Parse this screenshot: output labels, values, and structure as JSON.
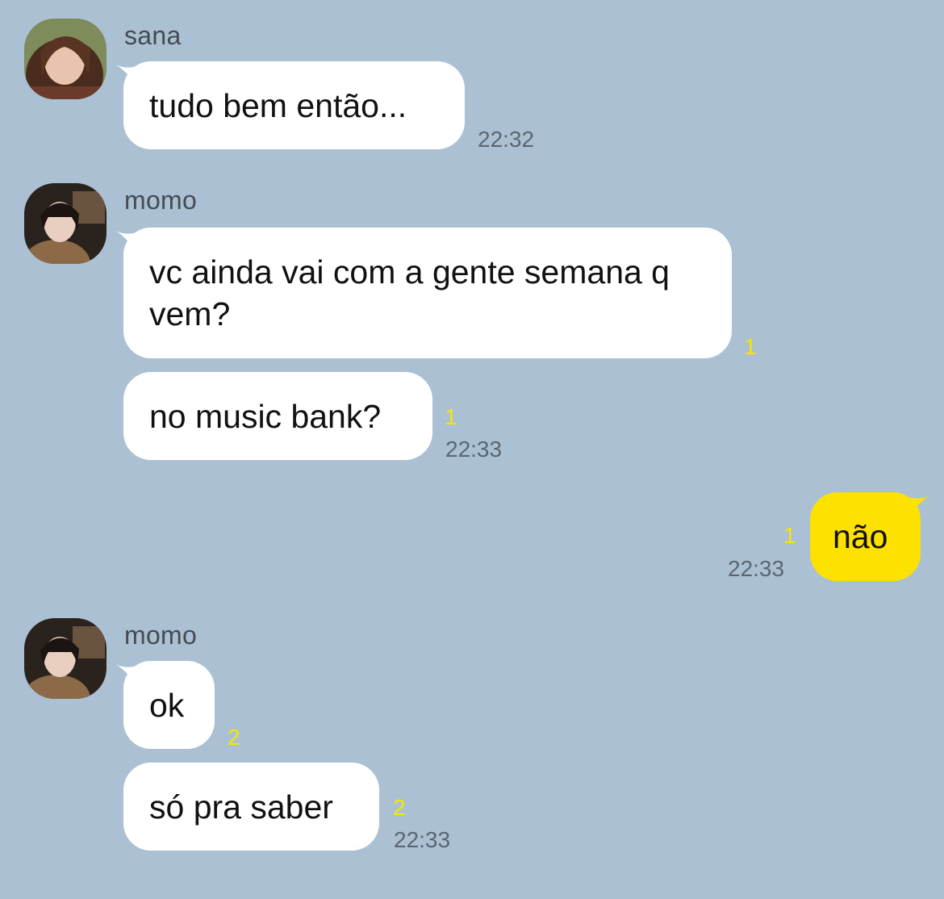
{
  "conversation": {
    "colors": {
      "background": "#abc1d3",
      "incoming_bubble": "#ffffff",
      "outgoing_bubble": "#fde100",
      "unread_count": "#f7e600",
      "timestamp": "#5b6670"
    },
    "groups": [
      {
        "sender": "sana",
        "avatar_icon": "profile-photo-icon",
        "messages": [
          {
            "text": "tudo bem então...",
            "unread": "",
            "time": "22:32"
          }
        ]
      },
      {
        "sender": "momo",
        "avatar_icon": "profile-photo-icon",
        "messages": [
          {
            "text": "vc ainda vai com a gente semana q vem?",
            "unread": "1",
            "time": ""
          },
          {
            "text": "no music bank?",
            "unread": "1",
            "time": "22:33"
          }
        ]
      },
      {
        "sender": "me",
        "outgoing": true,
        "messages": [
          {
            "text": "não",
            "unread": "1",
            "time": "22:33"
          }
        ]
      },
      {
        "sender": "momo",
        "avatar_icon": "profile-photo-icon",
        "messages": [
          {
            "text": "ok",
            "unread": "2",
            "time": ""
          },
          {
            "text": "só pra saber",
            "unread": "2",
            "time": "22:33"
          }
        ]
      }
    ]
  }
}
